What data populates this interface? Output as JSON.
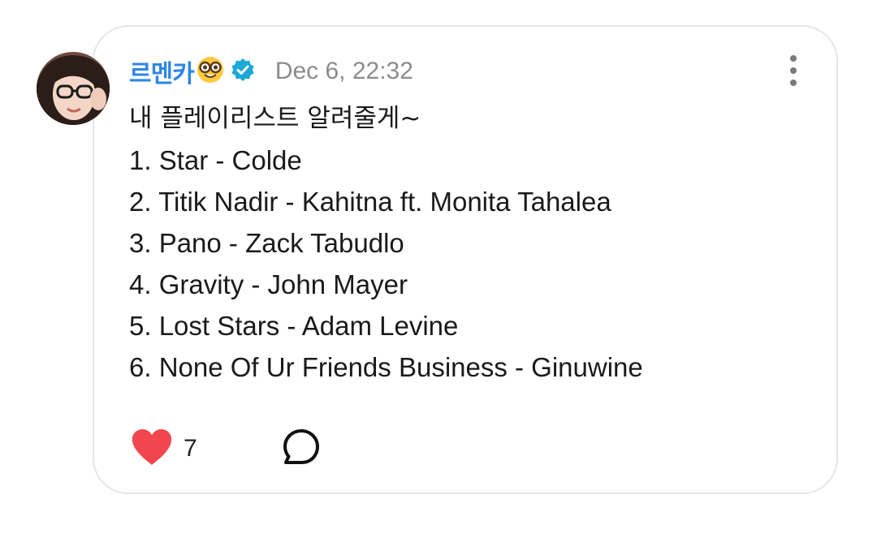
{
  "post": {
    "username": "르멘카",
    "username_emoji": "nerd-face-icon",
    "verified": true,
    "timestamp": "Dec 6, 22:32",
    "lines": [
      "내 플레이리스트 알려줄게~",
      "1. Star - Colde",
      "2. Titik Nadir - Kahitna ft. Monita Tahalea",
      "3. Pano - Zack Tabudlo",
      "4. Gravity - John Mayer",
      "5. Lost Stars - Adam Levine",
      "6. None Of Ur Friends Business - Ginuwine"
    ],
    "like_count": "7"
  },
  "colors": {
    "username": "#2f86e6",
    "verified_badge": "#1da8d8",
    "heart": "#f0474f",
    "timestamp": "#8c8c8c"
  },
  "icons": {
    "menu": "more-vertical-icon",
    "like": "heart-icon",
    "reply": "speech-bubble-icon"
  }
}
